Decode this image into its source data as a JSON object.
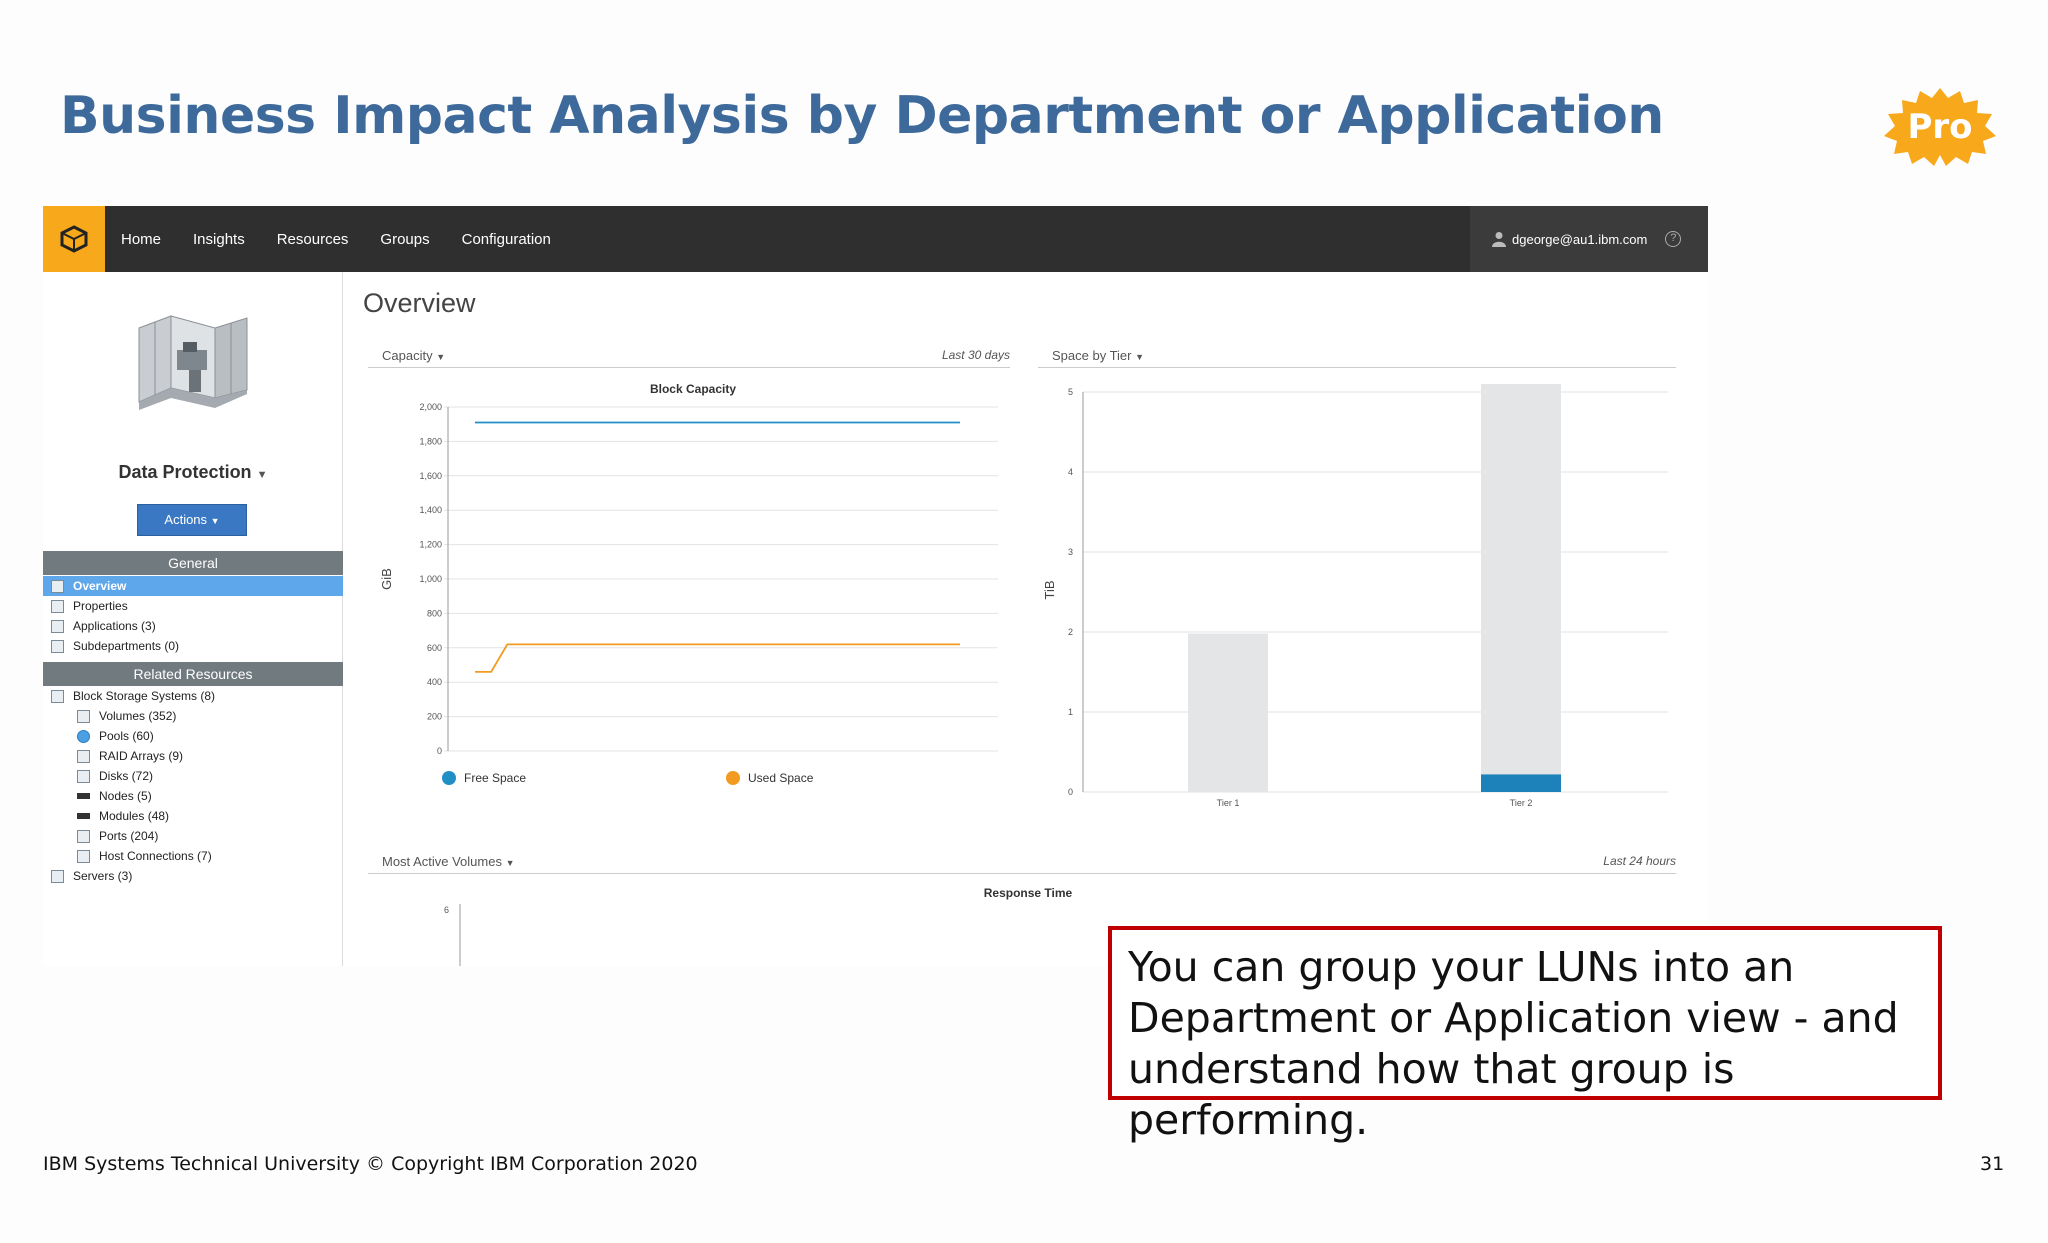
{
  "slide": {
    "title": "Business Impact Analysis by Department or Application",
    "badge": "Pro",
    "callout": "You can group your LUNs into an Department or Application view - and understand how that group is performing.",
    "footer_left": "IBM Systems Technical University  © Copyright IBM Corporation 2020",
    "page_number": "31"
  },
  "app": {
    "nav": [
      "Home",
      "Insights",
      "Resources",
      "Groups",
      "Configuration"
    ],
    "user": "dgeorge@au1.ibm.com",
    "entity_name": "Data Protection",
    "actions_label": "Actions",
    "main_title": "Overview",
    "sidebar": {
      "general_header": "General",
      "general_items": [
        "Overview",
        "Properties",
        "Applications (3)",
        "Subdepartments (0)"
      ],
      "related_header": "Related Resources",
      "related_items": [
        "Block Storage Systems (8)",
        "Volumes (352)",
        "Pools (60)",
        "RAID Arrays (9)",
        "Disks (72)",
        "Nodes (5)",
        "Modules (48)",
        "Ports (204)",
        "Host Connections (7)",
        "Servers (3)"
      ]
    },
    "capacity_panel": {
      "label": "Capacity",
      "range": "Last 30 days"
    },
    "tier_panel": {
      "label": "Space by Tier"
    },
    "active_panel": {
      "label": "Most Active Volumes",
      "range": "Last 24 hours"
    },
    "colors": {
      "free": "#1f8fc6",
      "used": "#f39a21",
      "tier_bar": "#e3e5e7",
      "tier_used": "#1e82ba"
    }
  },
  "chart_data": [
    {
      "type": "line",
      "title": "Block Capacity",
      "ylabel": "GiB",
      "ylim": [
        0,
        2000
      ],
      "yticks": [
        "2,000",
        "1,800",
        "1,600",
        "1,400",
        "1,200",
        "1,000",
        "800",
        "600",
        "400",
        "200",
        "0"
      ],
      "x": [
        0,
        1,
        2,
        3,
        30
      ],
      "series": [
        {
          "name": "Free Space",
          "values": [
            1910,
            1910,
            1910,
            1910,
            1910
          ]
        },
        {
          "name": "Used Space",
          "values": [
            460,
            460,
            620,
            620,
            620
          ]
        }
      ]
    },
    {
      "type": "bar",
      "ylabel": "TiB",
      "ylim": [
        0,
        5
      ],
      "yticks": [
        "5",
        "4",
        "3",
        "2",
        "1",
        "0"
      ],
      "categories": [
        "Tier 1",
        "Tier 2"
      ],
      "series": [
        {
          "name": "Used",
          "values": [
            0,
            0.22
          ]
        },
        {
          "name": "Free",
          "values": [
            1.98,
            4.88
          ]
        }
      ]
    },
    {
      "type": "line",
      "title": "Response Time",
      "yticks": [
        "6"
      ]
    }
  ]
}
